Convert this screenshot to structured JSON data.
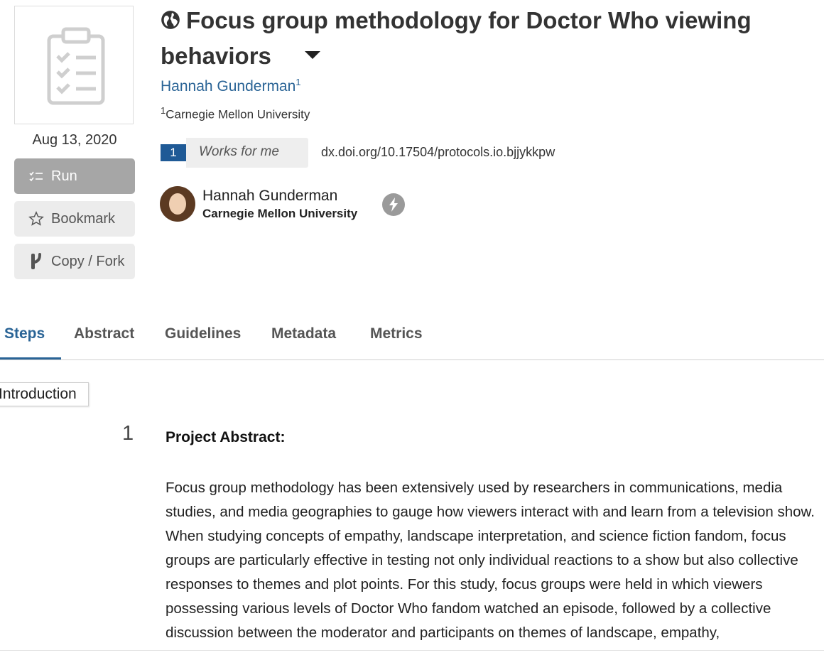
{
  "protocol": {
    "title": "Focus group methodology for Doctor Who viewing behaviors",
    "date": "Aug 13, 2020",
    "author_name": "Hannah Gunderman",
    "author_sup": "1",
    "affiliation_sup": "1",
    "affiliation": "Carnegie Mellon University",
    "works_for_me_count": "1",
    "works_for_me_label": "Works for me",
    "doi": "dx.doi.org/10.17504/protocols.io.bjjykkpw"
  },
  "creator": {
    "name": "Hannah Gunderman",
    "institution": "Carnegie Mellon University"
  },
  "actions": {
    "run": "Run",
    "bookmark": "Bookmark",
    "fork": "Copy / Fork"
  },
  "tabs": [
    {
      "label": "Steps",
      "active": true
    },
    {
      "label": "Abstract",
      "active": false
    },
    {
      "label": "Guidelines",
      "active": false
    },
    {
      "label": "Metadata",
      "active": false
    },
    {
      "label": "Metrics",
      "active": false
    }
  ],
  "section": {
    "label": "Introduction"
  },
  "step": {
    "number": "1",
    "heading": "Project Abstract:",
    "body": "Focus group methodology has been extensively used by researchers in communications, media studies, and media geographies to gauge how viewers interact with and learn from a television show. When studying concepts of empathy, landscape interpretation, and science fiction fandom, focus groups are particularly effective in testing not only individual reactions to a show but also collective responses to themes and plot points. For this study, focus groups were held in which viewers possessing various levels of Doctor Who fandom watched an episode, followed by a collective discussion between the moderator and participants on themes of landscape, empathy,"
  },
  "colors": {
    "link_blue": "#2a6496",
    "badge_blue": "#1f5a96",
    "run_button_gray": "#a6a6a6"
  },
  "icons": [
    "clipboard-checklist-icon",
    "globe-icon",
    "caret-down-icon",
    "run-list-icon",
    "star-outline-icon",
    "fork-icon",
    "lightning-icon"
  ]
}
